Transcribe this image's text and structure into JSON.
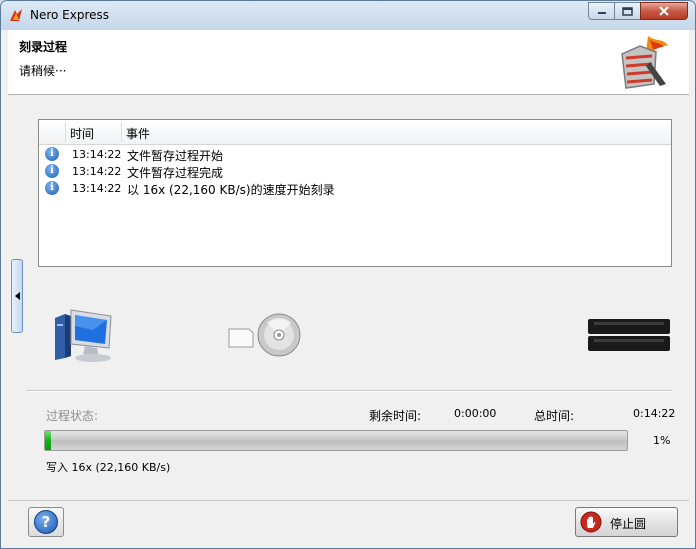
{
  "window": {
    "title": "Nero Express"
  },
  "header": {
    "title": "刻录过程",
    "subtitle": "请稍候···"
  },
  "log": {
    "columns": {
      "time": "时间",
      "event": "事件"
    },
    "rows": [
      {
        "time": "13:14:22",
        "event": "文件暂存过程开始"
      },
      {
        "time": "13:14:22",
        "event": "文件暂存过程完成"
      },
      {
        "time": "13:14:22",
        "event": "以 16x (22,160 KB/s)的速度开始刻录"
      }
    ]
  },
  "status": {
    "label": "过程状态:",
    "remaining_label": "剩余时间:",
    "remaining_value": "0:00:00",
    "total_label": "总时间:",
    "total_value": "0:14:22",
    "progress_percent": 1,
    "progress_text": "1%",
    "write_info": "写入 16x (22,160 KB/s)"
  },
  "buttons": {
    "help": "?",
    "stop": "停止圆"
  },
  "colors": {
    "progress_fill": "#10b410",
    "close_button": "#c75a46",
    "info_icon": "#1b5fb8"
  }
}
